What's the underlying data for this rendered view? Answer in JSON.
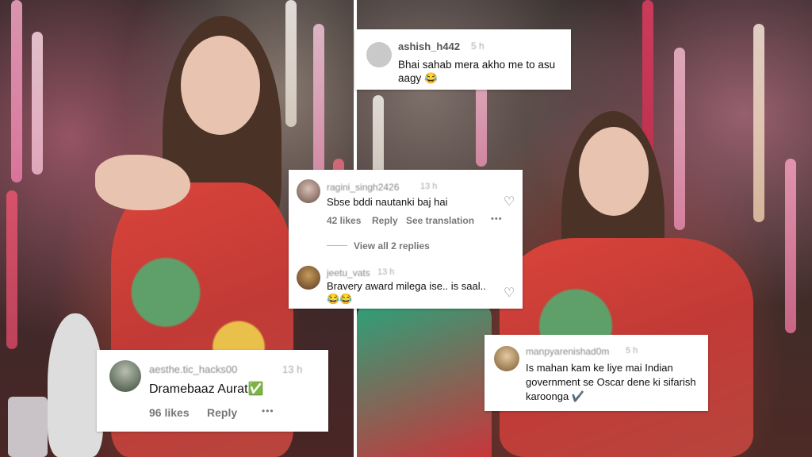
{
  "comments": [
    {
      "username": "ashish_h442",
      "time": "5 h",
      "text": "Bhai sahab mera akho me to asu aagy 😂"
    },
    {
      "username": "ragini_singh2426",
      "time": "13 h",
      "text": "Sbse bddi nautanki baj hai",
      "likes": "42 likes",
      "reply": "Reply",
      "translate": "See translation",
      "view_replies": "View all 2 replies",
      "more": "•••"
    },
    {
      "username": "jeetu_vats",
      "time": "13 h",
      "text": "Bravery award milega ise.. is saal.. 😂😂"
    },
    {
      "username": "aesthe.tic_hacks00",
      "time": "13 h",
      "text": "Dramebaaz Aurat✅",
      "likes": "96 likes",
      "reply": "Reply",
      "more": "•••"
    },
    {
      "username": "manpyarenishad0m",
      "time": "5 h",
      "text": "Is mahan kam ke liye mai Indian government se Oscar dene ki sifarish karoonga ✔️"
    }
  ],
  "icons": {
    "heart": "heart-outline-icon",
    "more": "ellipsis-icon"
  }
}
